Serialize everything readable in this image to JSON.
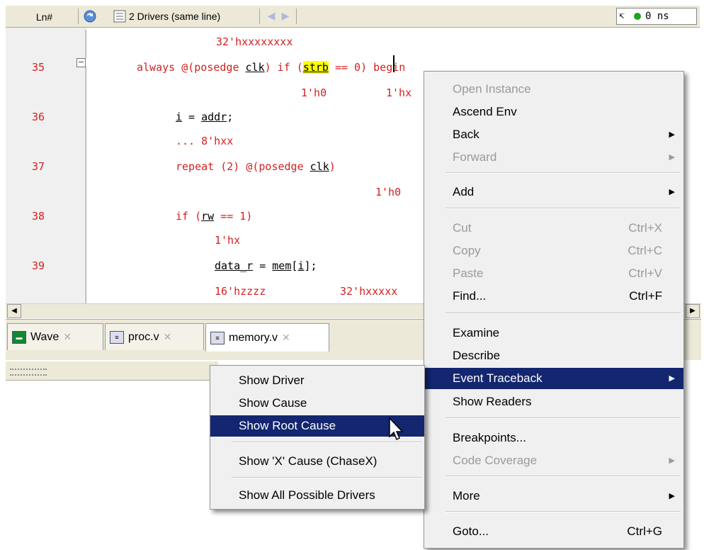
{
  "toolbar": {
    "ln_header": "Ln#",
    "drivers_label": "2 Drivers (same line)",
    "time_readout": "0 ns"
  },
  "code_lines": {
    "l34_value": "32'hxxxxxxxx",
    "l35_num": "35",
    "l35_a": "always ",
    "l35_b": "@(posedge ",
    "l35_clk": "clk",
    "l35_c": ") if (",
    "l35_strb": "strb",
    "l35_d": " == 0) begin",
    "l35_v1": "1'h0",
    "l35_v2": "1'hx",
    "l36_num": "36",
    "l36_i": "i",
    "l36_eq": " = ",
    "l36_addr": "addr",
    "l36_semi": ";",
    "l36_v": "... 8'hxx",
    "l37_num": "37",
    "l37_a": "repeat ",
    "l37_b": "(2) @(posedge ",
    "l37_clk": "clk",
    "l37_c": ")",
    "l37_v": "1'h0",
    "l38_num": "38",
    "l38_a": "if (",
    "l38_rw": "rw",
    "l38_b": " == 1)",
    "l38_v": "1'hx",
    "l39_num": "39",
    "l39_data": "data_r",
    "l39_eq": " = ",
    "l39_mem": "mem",
    "l39_br1": "[",
    "l39_i": "i",
    "l39_br2": "];",
    "l39_v1": "16'hzzzz",
    "l39_v2": "32'hxxxxx"
  },
  "tabs": [
    {
      "label": "Wave"
    },
    {
      "label": "proc.v"
    },
    {
      "label": "memory.v"
    }
  ],
  "context_menu": {
    "open_instance": "Open Instance",
    "ascend_env": "Ascend Env",
    "back": "Back",
    "forward": "Forward",
    "add": "Add",
    "cut": "Cut",
    "cut_sc": "Ctrl+X",
    "copy": "Copy",
    "copy_sc": "Ctrl+C",
    "paste": "Paste",
    "paste_sc": "Ctrl+V",
    "find": "Find...",
    "find_sc": "Ctrl+F",
    "examine": "Examine",
    "describe": "Describe",
    "event_traceback": "Event Traceback",
    "show_readers": "Show Readers",
    "breakpoints": "Breakpoints...",
    "code_coverage": "Code Coverage",
    "more": "More",
    "goto": "Goto...",
    "goto_sc": "Ctrl+G"
  },
  "submenu": {
    "show_driver": "Show Driver",
    "show_cause": "Show Cause",
    "show_root_cause": "Show Root Cause",
    "show_x_cause": "Show 'X' Cause (ChaseX)",
    "show_all_drivers": "Show All Possible Drivers"
  },
  "colors": {
    "line_number": "#d52020",
    "keyword": "#1a1aa8",
    "highlight": "#ffff00",
    "menu_selection": "#13266f"
  }
}
